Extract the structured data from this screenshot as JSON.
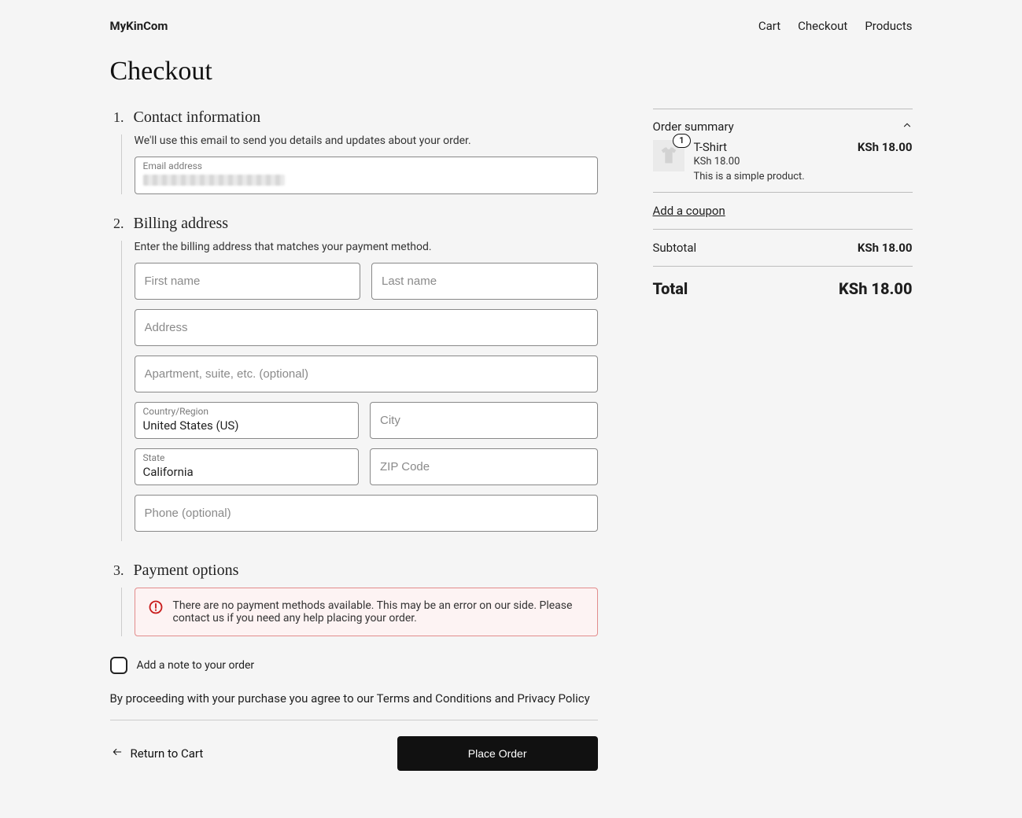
{
  "brand": "MyKinCom",
  "nav": {
    "cart": "Cart",
    "checkout": "Checkout",
    "products": "Products"
  },
  "page_title": "Checkout",
  "steps": {
    "contact": {
      "title": "Contact information",
      "desc": "We'll use this email to send you details and updates about your order.",
      "email_label": "Email address"
    },
    "billing": {
      "title": "Billing address",
      "desc": "Enter the billing address that matches your payment method.",
      "first_name_ph": "First name",
      "last_name_ph": "Last name",
      "address_ph": "Address",
      "apt_ph": "Apartment, suite, etc. (optional)",
      "country_label": "Country/Region",
      "country_value": "United States (US)",
      "city_ph": "City",
      "state_label": "State",
      "state_value": "California",
      "zip_ph": "ZIP Code",
      "phone_ph": "Phone (optional)"
    },
    "payment": {
      "title": "Payment options",
      "error": "There are no payment methods available. This may be an error on our side. Please contact us if you need any help placing your order."
    }
  },
  "note_label": "Add a note to your order",
  "agree_text": "By proceeding with your purchase you agree to our Terms and Conditions and Privacy Policy",
  "return_label": "Return to Cart",
  "place_label": "Place Order",
  "summary": {
    "header": "Order summary",
    "item": {
      "qty": "1",
      "name": "T-Shirt",
      "unit_price": "KSh 18.00",
      "desc": "This is a simple product.",
      "line_price": "KSh 18.00"
    },
    "coupon": "Add a coupon",
    "subtotal_label": "Subtotal",
    "subtotal_value": "KSh 18.00",
    "total_label": "Total",
    "total_value": "KSh 18.00"
  }
}
